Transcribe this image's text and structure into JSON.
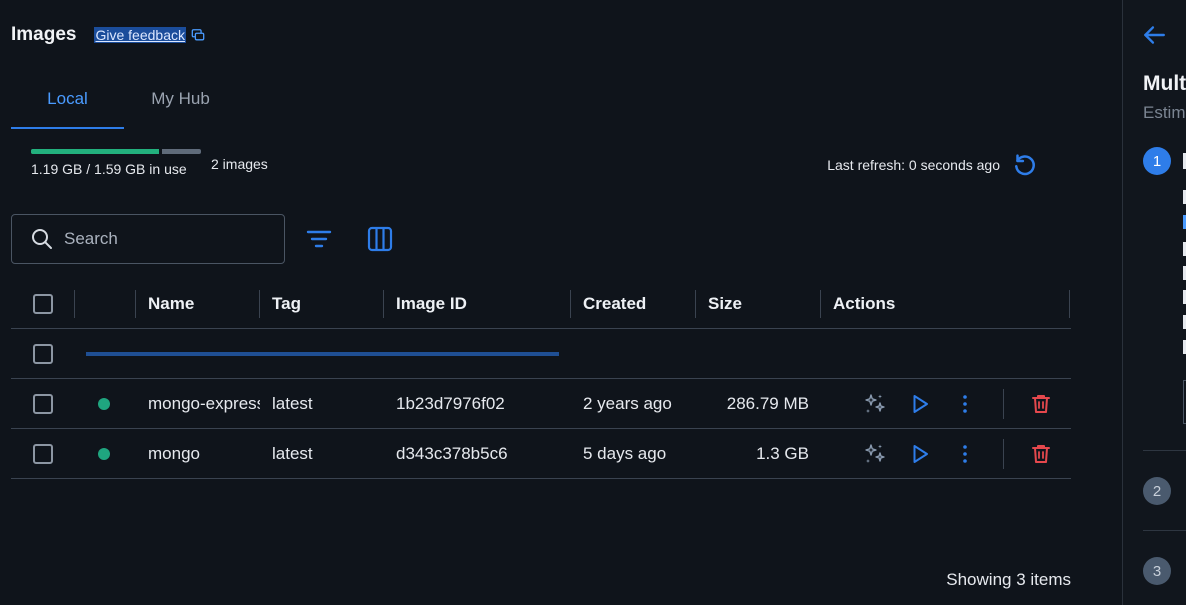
{
  "header": {
    "title": "Images",
    "feedback_label": "Give feedback"
  },
  "tabs": [
    {
      "label": "Local",
      "active": true
    },
    {
      "label": "My Hub",
      "active": false
    }
  ],
  "usage": {
    "text": "1.19 GB / 1.59 GB in use",
    "used_fraction": 0.75,
    "image_count": "2 images"
  },
  "refresh": {
    "text": "Last refresh: 0 seconds ago"
  },
  "search": {
    "placeholder": "Search"
  },
  "table": {
    "columns": [
      "Name",
      "Tag",
      "Image ID",
      "Created",
      "Size",
      "Actions"
    ],
    "rows": [
      {
        "name": "mongo-express",
        "tag": "latest",
        "image_id": "1b23d7976f02",
        "created": "2 years ago",
        "size": "286.79 MB",
        "status": "in-use"
      },
      {
        "name": "mongo",
        "tag": "latest",
        "image_id": "d343c378b5c6",
        "created": "5 days ago",
        "size": "1.3 GB",
        "status": "in-use"
      }
    ]
  },
  "footer": {
    "text": "Showing 3 items"
  },
  "panel": {
    "title_fragment": "Mult",
    "subtitle_fragment": "Estim",
    "steps": [
      "1",
      "2",
      "3"
    ]
  },
  "colors": {
    "background": "#0f141b",
    "accent": "#2e7de9",
    "status_green": "#1fa57f",
    "danger": "#e5484d"
  }
}
